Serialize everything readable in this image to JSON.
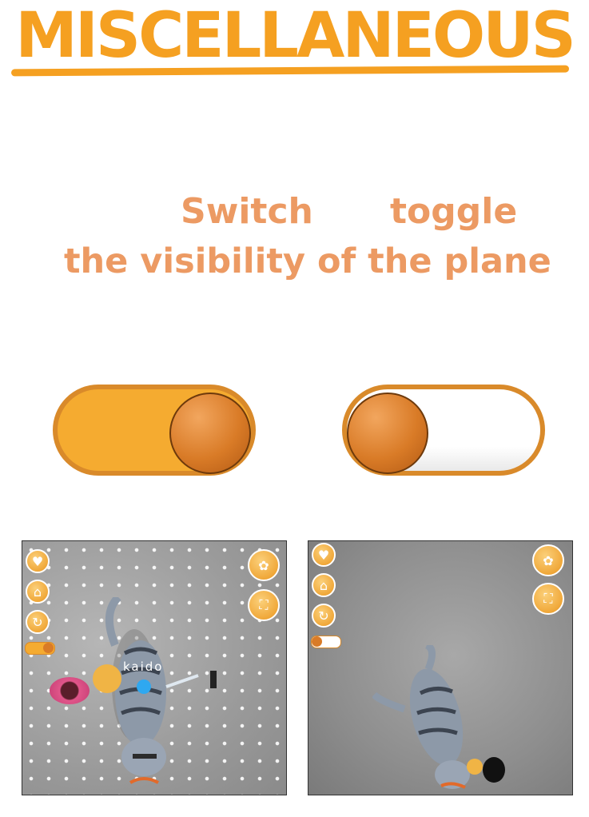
{
  "header": {
    "title": "MISCELLANEOUS"
  },
  "instructions": {
    "word_switch": "Switch",
    "word_toggle": "toggle",
    "line2": "the visibility of the plane"
  },
  "toggles": [
    {
      "state": "on",
      "fill_color": "#f5ab30"
    },
    {
      "state": "off",
      "fill_color": "#ffffff"
    }
  ],
  "screens": [
    {
      "plane_visible": true,
      "cat_name": "kaido"
    },
    {
      "plane_visible": false
    }
  ],
  "colors": {
    "accent": "#f5a021",
    "text": "#ec9a63",
    "knob": "#d97b27"
  },
  "icons": [
    "heart-icon",
    "bath-icon",
    "refresh-icon",
    "paw-icon",
    "fullscreen-icon"
  ]
}
